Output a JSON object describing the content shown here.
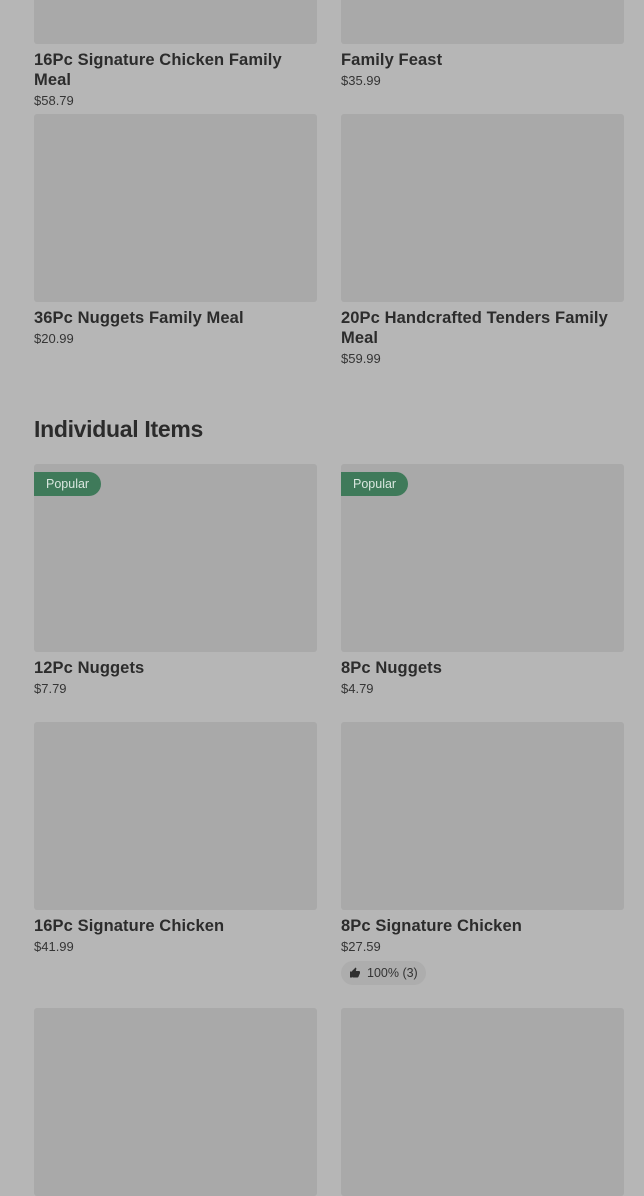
{
  "family_meals": [
    {
      "name": "16Pc Signature Chicken Family Meal",
      "price": "$58.79"
    },
    {
      "name": "Family Feast",
      "price": "$35.99"
    },
    {
      "name": "36Pc Nuggets Family Meal",
      "price": "$20.99"
    },
    {
      "name": "20Pc Handcrafted Tenders Family Meal",
      "price": "$59.99"
    }
  ],
  "individual_section": {
    "title": "Individual Items",
    "items": [
      {
        "name": "12Pc Nuggets",
        "price": "$7.79",
        "badge": "Popular"
      },
      {
        "name": "8Pc Nuggets",
        "price": "$4.79",
        "badge": "Popular"
      },
      {
        "name": "16Pc Signature Chicken",
        "price": "$41.99"
      },
      {
        "name": "8Pc Signature Chicken",
        "price": "$27.59",
        "rating": "100% (3)",
        "rating_icon": "thumbs-up-icon"
      }
    ]
  },
  "colors": {
    "overlay_background": "#b6b6b6",
    "image_placeholder": "#a9a9a9",
    "popular_badge": "#3f7a5a"
  }
}
